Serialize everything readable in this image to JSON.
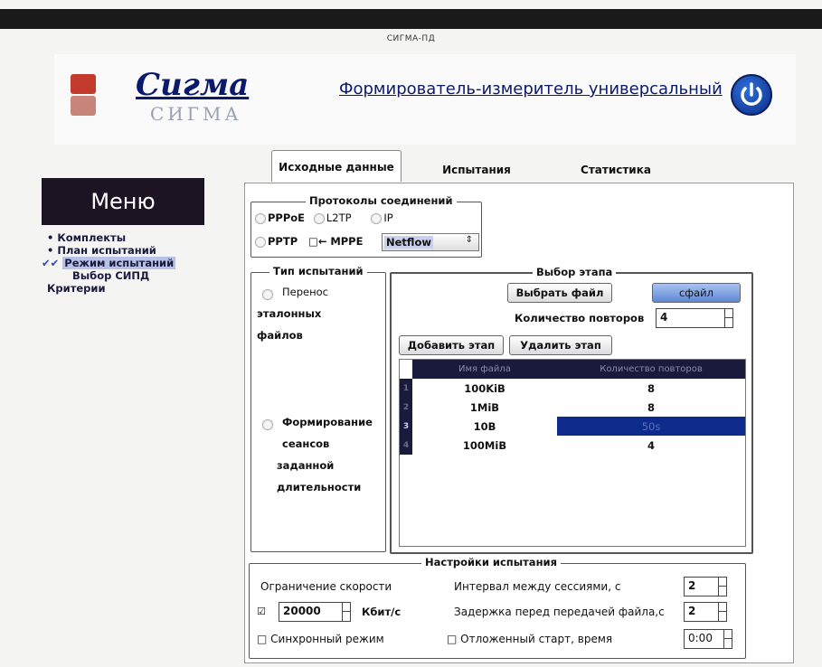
{
  "window": {
    "title": "СИГМА-ПД"
  },
  "header": {
    "brand": "Cигма",
    "brand_sub": "СИГМА",
    "headline": "Формирователь-измеритель универсальный"
  },
  "menu": {
    "title": "Меню",
    "items": [
      {
        "label": "• Комплекты"
      },
      {
        "label": "• План испытаний"
      },
      {
        "label": "Режим испытаний",
        "prefix": "✔✔"
      },
      {
        "label": "Выбор СИПД"
      },
      {
        "label": "Критерии"
      }
    ]
  },
  "tabs": [
    {
      "label": "Исходные данные",
      "active": true
    },
    {
      "label": "Испытания",
      "active": false
    },
    {
      "label": "Статистика",
      "active": false
    }
  ],
  "protocols": {
    "legend": "Протоколы соединений",
    "pppoe": "PPPoE",
    "l2tp": "L2TP",
    "ip": "IP",
    "pptp": "PPTP",
    "mppe_prefix": "□←",
    "mppe": "MPPE",
    "select_value": "Netflow"
  },
  "test_type": {
    "legend": "Тип испытаний",
    "option1": [
      "Перенос",
      "эталонных",
      "файлов"
    ],
    "option2": [
      "Формирование",
      "сеансов",
      "заданной",
      "длительности"
    ]
  },
  "stage": {
    "legend": "Выбор этапа",
    "choose_file": "Выбрать файл",
    "source_value": "сфайл",
    "repeat_label": "Количество повторов",
    "repeat_value": "4",
    "add_button": "Добавить этап",
    "remove_button": "Удалить этап",
    "columns": [
      "Имя файла",
      "Количество повторов"
    ],
    "rows": [
      {
        "num": "1",
        "name": "100KiB",
        "count": "8"
      },
      {
        "num": "2",
        "name": "1MiB",
        "count": "8"
      },
      {
        "num": "3",
        "name": "10B",
        "count": "50s"
      },
      {
        "num": "4",
        "name": "100MiB",
        "count": "4"
      }
    ]
  },
  "settings": {
    "legend": "Настройки испытания",
    "speed_limit_label": "Ограничение скорости",
    "speed_check": "☑",
    "speed_value": "20000",
    "speed_unit": "Кбит/с",
    "interval_label": "Интервал между сессиями, с",
    "interval_value": "2",
    "delay_label": "Задержка перед передачей файла,с",
    "delay_value": "2",
    "sync_label": "□ Синхронный режим",
    "delayed_start_label": "□ Отложенный старт, время",
    "delayed_start_value": "0:00"
  }
}
